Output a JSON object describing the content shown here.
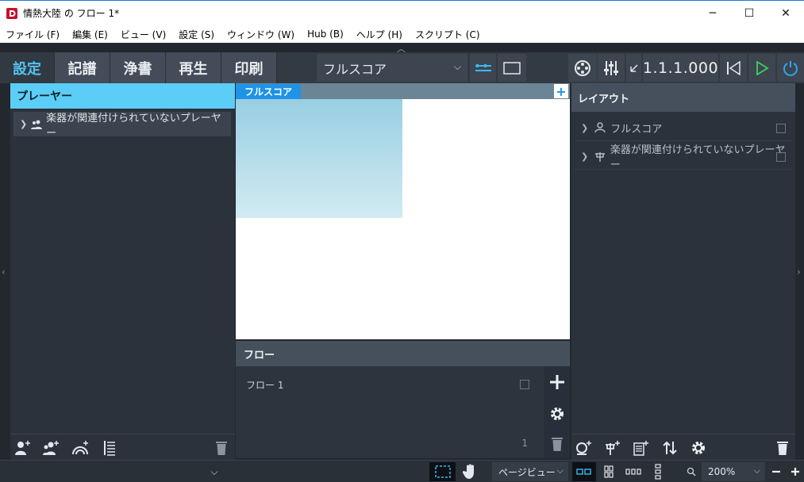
{
  "window": {
    "title": "情熱大陸 の フロー 1*",
    "controls": [
      "─",
      "☐",
      "✕"
    ]
  },
  "menu": [
    "ファイル (F)",
    "編集 (E)",
    "ビュー (V)",
    "設定 (S)",
    "ウィンドウ (W)",
    "Hub (B)",
    "ヘルプ (H)",
    "スクリプト (C)"
  ],
  "toolbar": {
    "modes": [
      "設定",
      "記譜",
      "浄書",
      "再生",
      "印刷"
    ],
    "active_mode": "設定",
    "layout_select": "フルスコア",
    "position_counter": "1.1.1.000"
  },
  "players_panel": {
    "title": "プレーヤー",
    "items": [
      {
        "label": "楽器が関連付けられていないプレーヤー"
      }
    ]
  },
  "score": {
    "tab_label": "フルスコア",
    "add_tab_label": "+"
  },
  "flows_panel": {
    "title": "フロー",
    "items": [
      {
        "label": "フロー 1",
        "number": "1"
      }
    ]
  },
  "layouts_panel": {
    "title": "レイアウト",
    "items": [
      {
        "label": "フルスコア",
        "icon": "full-score-icon"
      },
      {
        "label": "楽器が関連付けられていないプレーヤー",
        "icon": "part-layout-icon"
      }
    ]
  },
  "statusbar": {
    "view_mode": "ページビュー",
    "zoom": "200%"
  },
  "colors": {
    "accent": "#5ccdf6",
    "tab_blue": "#1f93e6",
    "play_green": "#3ecf5e",
    "power_blue": "#2aa6ef"
  }
}
